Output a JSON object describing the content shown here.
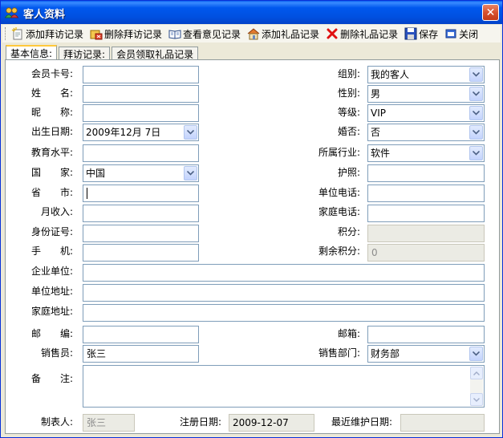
{
  "window": {
    "title": "客人资料",
    "close_symbol": "✕"
  },
  "toolbar": {
    "items": [
      {
        "label": "添加拜访记录",
        "icon": "add-record-icon"
      },
      {
        "label": "删除拜访记录",
        "icon": "delete-record-icon"
      },
      {
        "label": "查看意见记录",
        "icon": "book-icon"
      },
      {
        "label": "添加礼品记录",
        "icon": "gift-icon"
      },
      {
        "label": "删除礼品记录",
        "icon": "red-x-icon"
      },
      {
        "label": "保存",
        "icon": "save-disk-icon"
      },
      {
        "label": "关闭",
        "icon": "close-window-icon"
      }
    ]
  },
  "tabs": [
    "基本信息:",
    "拜访记录:",
    "会员领取礼品记录"
  ],
  "form": {
    "member_card_label": "会员卡号:",
    "member_card_value": "",
    "group_label": "组别:",
    "group_value": "我的客人",
    "name_label": "姓　　名:",
    "name_value": "",
    "gender_label": "性别:",
    "gender_value": "男",
    "nickname_label": "昵　　称:",
    "nickname_value": "",
    "level_label": "等级:",
    "level_value": "VIP",
    "birthday_label": "出生日期:",
    "birthday_value": "2009年12月 7日",
    "married_label": "婚否:",
    "married_value": "否",
    "education_label": "教育水平:",
    "education_value": "",
    "industry_label": "所属行业:",
    "industry_value": "软件",
    "country_label": "国　　家:",
    "country_value": "中国",
    "passport_label": "护照:",
    "passport_value": "",
    "province_label": "省　　市:",
    "province_value": "",
    "work_phone_label": "单位电话:",
    "work_phone_value": "",
    "income_label": "月收入:",
    "income_value": "",
    "home_phone_label": "家庭电话:",
    "home_phone_value": "",
    "id_card_label": "身份证号:",
    "id_card_value": "",
    "points_label": "积分:",
    "points_value": "",
    "mobile_label": "手　　机:",
    "mobile_value": "",
    "remaining_points_label": "剩余积分:",
    "remaining_points_value": "0",
    "company_label": "企业单位:",
    "company_value": "",
    "company_address_label": "单位地址:",
    "company_address_value": "",
    "home_address_label": "家庭地址:",
    "home_address_value": "",
    "postcode_label": "邮　　编:",
    "postcode_value": "",
    "email_label": "邮箱:",
    "email_value": "",
    "salesperson_label": "销售员:",
    "salesperson_value": "张三",
    "sales_dept_label": "销售部门:",
    "sales_dept_value": "财务部",
    "remarks_label": "备　　注:",
    "remarks_value": "",
    "creator_label": "制表人:",
    "creator_value": "张三",
    "register_date_label": "注册日期:",
    "register_date_value": "2009-12-07",
    "last_maintain_label": "最近维护日期:",
    "last_maintain_value": ""
  },
  "colors": {
    "titlebar": "#0054E3",
    "close_button": "#D8512E",
    "window_bg": "#ECE9D8",
    "field_border": "#7F9DB9",
    "disabled_field": "#EBEBE4",
    "tab_highlight": "#FFC83C"
  }
}
